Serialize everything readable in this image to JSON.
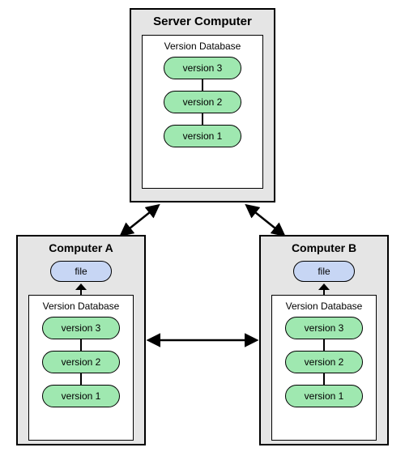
{
  "server": {
    "title": "Server Computer",
    "db_title": "Version Database",
    "versions": {
      "v3": "version 3",
      "v2": "version 2",
      "v1": "version 1"
    }
  },
  "computer_a": {
    "title": "Computer A",
    "file_label": "file",
    "db_title": "Version Database",
    "versions": {
      "v3": "version 3",
      "v2": "version 2",
      "v1": "version 1"
    }
  },
  "computer_b": {
    "title": "Computer B",
    "file_label": "file",
    "db_title": "Version Database",
    "versions": {
      "v3": "version 3",
      "v2": "version 2",
      "v1": "version 1"
    }
  },
  "colors": {
    "box_bg": "#e5e5e5",
    "file_bg": "#c7d6f4",
    "version_bg": "#9fe8b0"
  }
}
